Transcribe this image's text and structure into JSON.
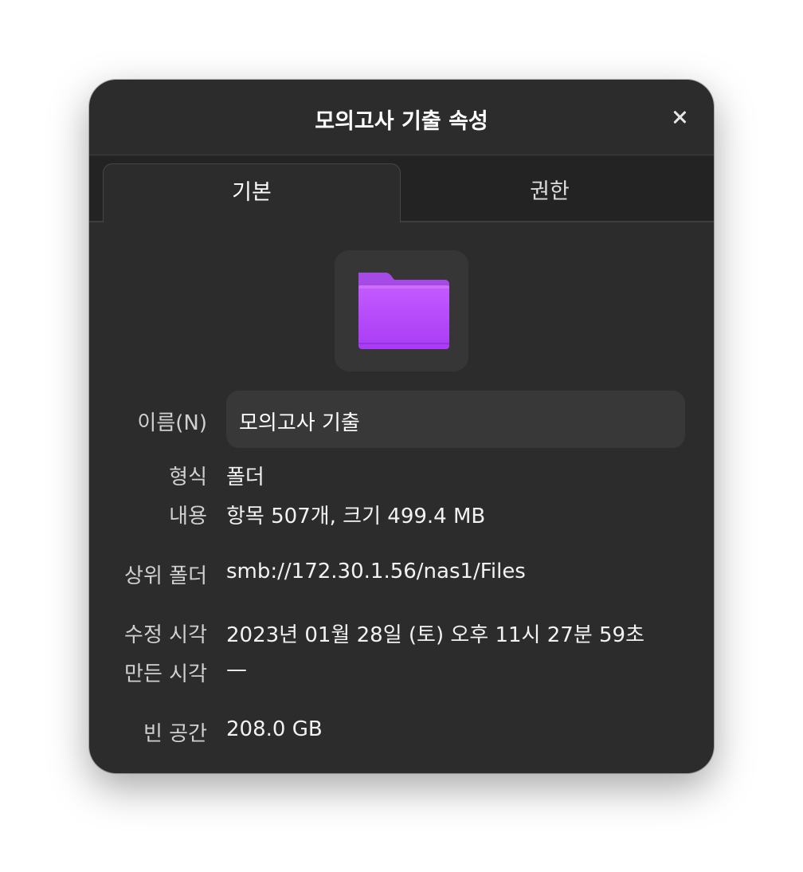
{
  "window": {
    "title": "모의고사 기출 속성",
    "close_icon": "close-icon"
  },
  "tabs": [
    {
      "label": "기본",
      "active": true
    },
    {
      "label": "권한",
      "active": false
    }
  ],
  "folder_icon": {
    "name": "folder-icon",
    "color": "#b84eff"
  },
  "properties": {
    "name_label": "이름(N)",
    "name_value": "모의고사 기출",
    "type_label": "형식",
    "type_value": "폴더",
    "contents_label": "내용",
    "contents_value": "항목 507개, 크기 499.4 MB",
    "parent_label": "상위 폴더",
    "parent_value": "smb://172.30.1.56/nas1/Files",
    "modified_label": "수정 시각",
    "modified_value": "2023년 01월 28일 (토) 오후 11시 27분 59초",
    "created_label": "만든 시각",
    "created_value": "—",
    "free_space_label": "빈 공간",
    "free_space_value": "208.0 GB"
  }
}
